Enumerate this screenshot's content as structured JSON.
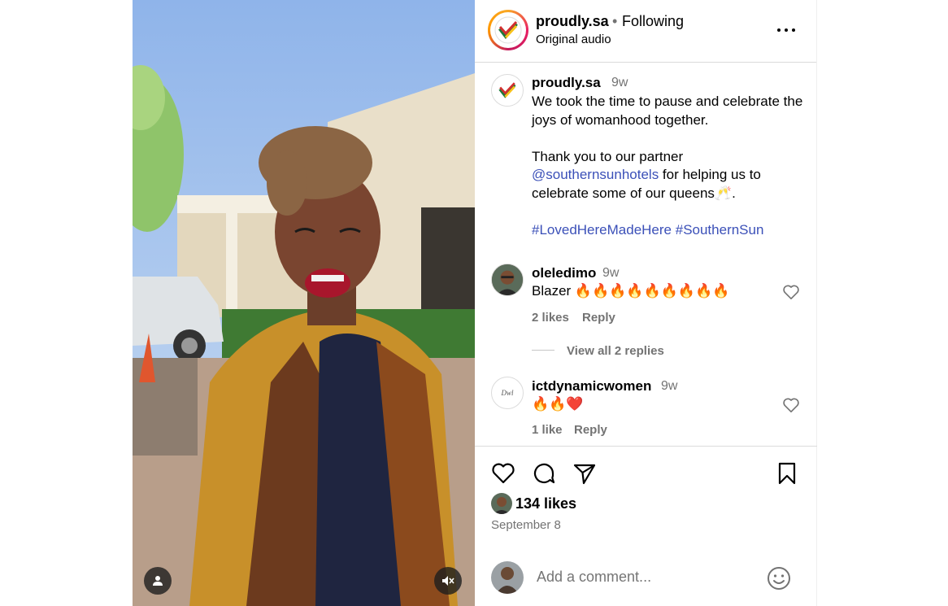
{
  "header": {
    "username": "proudly.sa",
    "separator": "•",
    "follow_status": "Following",
    "audio": "Original audio",
    "more_icon": "more-horizontal-icon"
  },
  "caption": {
    "username": "proudly.sa",
    "time": "9w",
    "line1": "We took the time to pause and celebrate the joys of womanhood together.",
    "line2_prefix": "Thank you to our partner ",
    "line2_mention": "@southernsunhotels",
    "line2_suffix": " for helping us to celebrate some of our queens🥂.",
    "hashtag1": "#LovedHereMadeHere",
    "hashtag2": "#SouthernSun"
  },
  "comments": [
    {
      "username": "oleledimo",
      "time": "9w",
      "text": "Blazer 🔥🔥🔥🔥🔥🔥🔥🔥🔥",
      "likes": "2 likes",
      "reply": "Reply",
      "view_replies": "View all 2 replies"
    },
    {
      "username": "ictdynamicwomen",
      "time": "9w",
      "text": "🔥🔥❤️",
      "likes": "1 like",
      "reply": "Reply"
    }
  ],
  "actions": {
    "like_icon": "heart-icon",
    "comment_icon": "comment-icon",
    "share_icon": "send-icon",
    "save_icon": "bookmark-icon",
    "likes_count": "134 likes",
    "date": "September 8",
    "comment_placeholder": "Add a comment...",
    "emoji_icon": "smiley-icon"
  },
  "media": {
    "user_tag_icon": "person-icon",
    "mute_icon": "speaker-muted-icon"
  },
  "colors": {
    "link": "#3b50b8",
    "secondary_text": "#737373",
    "divider": "#dbdbdb"
  }
}
